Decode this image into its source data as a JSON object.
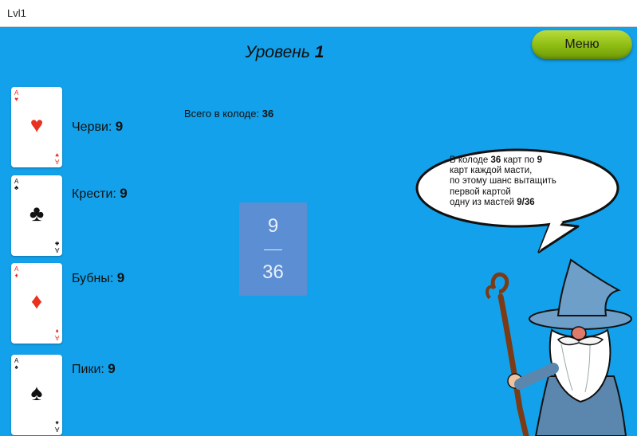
{
  "window": {
    "title": "Lvl1"
  },
  "header": {
    "level_word": "Уровень",
    "level_number": "1",
    "menu_label": "Меню"
  },
  "suits": [
    {
      "name": "Черви:",
      "count": "9",
      "rank": "A",
      "symbol": "♥",
      "color": "#e8321f"
    },
    {
      "name": "Крести:",
      "count": "9",
      "rank": "A",
      "symbol": "♣",
      "color": "#111111"
    },
    {
      "name": "Бубны:",
      "count": "9",
      "rank": "A",
      "symbol": "♦",
      "color": "#e8321f"
    },
    {
      "name": "Пики:",
      "count": "9",
      "rank": "A",
      "symbol": "♠",
      "color": "#111111"
    }
  ],
  "deck": {
    "label": "Всего в колоде:",
    "total": "36"
  },
  "fraction": {
    "numerator": "9",
    "denominator": "36"
  },
  "speech": {
    "p1": "В колоде",
    "b1": "36",
    "p2": "карт по",
    "b2": "9",
    "line2": "карт каждой масти,",
    "line3": "по этому шанс вытащить",
    "line4": "первой картой",
    "p5": "одну из мастей",
    "b5": "9/36"
  },
  "colors": {
    "background": "#12a1ea",
    "menu_button": "#8dbb12",
    "fraction_card": "#5b8ed3",
    "wizard_robe": "#5b86ad"
  }
}
